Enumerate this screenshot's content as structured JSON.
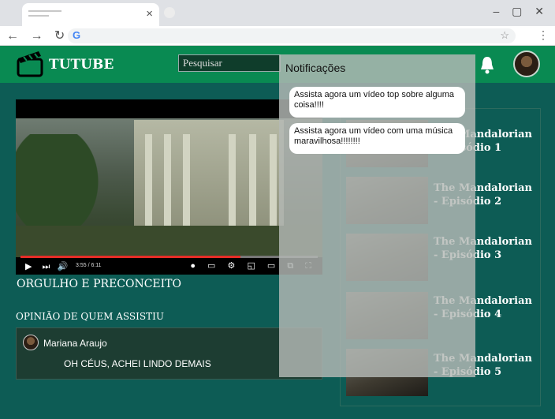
{
  "browser": {
    "window_controls": "– ▢ ✕",
    "tab_close": "×",
    "nav": "← → ↻",
    "search_engine_icon": "G",
    "star": "☆",
    "menu": "⋮"
  },
  "header": {
    "brand": "TUTUBE",
    "search_placeholder": "Pesquisar"
  },
  "player": {
    "time": "3:55 / 6:11",
    "progress": 0.74
  },
  "video": {
    "title": "ORGULHO E PRECONCEITO"
  },
  "reviews": {
    "section_title": "OPINIÃO DE QUEM ASSISTIU",
    "items": [
      {
        "author": "Mariana Araujo",
        "text": "OH CÉUS, ACHEI LINDO DEMAIS"
      }
    ]
  },
  "sidebar": {
    "items": [
      {
        "title": "The Mandalorian - Episódio 1"
      },
      {
        "title": "The Mandalorian - Episódio 2"
      },
      {
        "title": "The Mandalorian - Episódio 3"
      },
      {
        "title": "The Mandalorian - Episódio 4"
      },
      {
        "title": "The Mandalorian - Episódio 5"
      }
    ]
  },
  "notifications": {
    "title": "Notificações",
    "items": [
      {
        "text": "Assista agora um vídeo top sobre alguma coisa!!!!"
      },
      {
        "text": "Assista agora um vídeo com uma música maravilhosa!!!!!!!!"
      }
    ]
  },
  "colors": {
    "header_bg": "#098a52",
    "page_bg": "#0d5c55",
    "progress": "#e52d27"
  }
}
